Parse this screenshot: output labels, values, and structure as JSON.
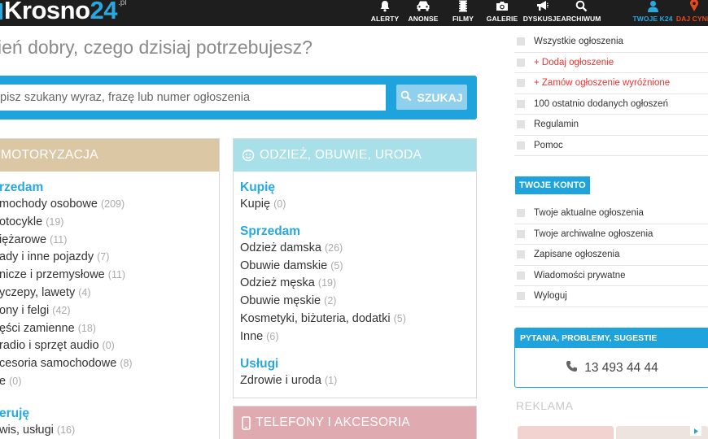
{
  "header": {
    "logo_text": "Krosno",
    "logo_num": "24",
    "logo_suffix": ".pl",
    "nav": [
      {
        "label": "ALERTY",
        "icon": "bell-icon"
      },
      {
        "label": "ANONSE",
        "icon": "car-icon"
      },
      {
        "label": "FILMY",
        "icon": "film-icon"
      },
      {
        "label": "GALERIE",
        "icon": "camera-icon"
      },
      {
        "label": "DYSKUSJE",
        "icon": "megaphone-icon"
      },
      {
        "label": "ARCHIWUM",
        "icon": "search-icon"
      },
      {
        "label": "TWOJE K24",
        "icon": "user-icon"
      },
      {
        "label": "DAJ CYNK",
        "icon": "pin-icon"
      }
    ]
  },
  "greeting": "ień dobry, czego dzisiaj potrzebujesz?",
  "search": {
    "placeholder": "pisz szukany wyraz, frazę lub numer ogłoszenia",
    "button_label": "SZUKAJ"
  },
  "colors": {
    "accent": "#1fa3dc",
    "moto_header": "#dcc7a5",
    "odziez_header": "#a8e0ea",
    "telefony_header": "#dfaab0"
  },
  "categories": {
    "moto": {
      "title": "MOTORYZACJA",
      "sections": [
        {
          "title": "rzedam",
          "items": [
            {
              "label": "mochody osobowe",
              "count": "(209)"
            },
            {
              "label": "otocykle",
              "count": "(19)"
            },
            {
              "label": "iężarowe",
              "count": "(11)"
            },
            {
              "label": "ady i inne pojazdy",
              "count": "(7)"
            },
            {
              "label": "nicze i przemysłowe",
              "count": "(11)"
            },
            {
              "label": "yczepy, lawety",
              "count": "(4)"
            },
            {
              "label": "ony i felgi",
              "count": "(42)"
            },
            {
              "label": "ęści zamienne",
              "count": "(18)"
            },
            {
              "label": "radio i sprzęt audio",
              "count": "(0)"
            },
            {
              "label": "cesoria samochodowe",
              "count": "(8)"
            },
            {
              "label": "e",
              "count": "(0)"
            }
          ]
        },
        {
          "title": "eruję",
          "items": [
            {
              "label": "wis, usługi",
              "count": "(16)"
            }
          ]
        }
      ]
    },
    "odziez": {
      "title": "ODZIEŻ, OBUWIE, URODA",
      "sections": [
        {
          "title": "Kupię",
          "items": [
            {
              "label": "Kupię",
              "count": "(0)"
            }
          ]
        },
        {
          "title": "Sprzedam",
          "items": [
            {
              "label": "Odzież damska",
              "count": "(26)"
            },
            {
              "label": "Obuwie damskie",
              "count": "(5)"
            },
            {
              "label": "Odzież męska",
              "count": "(19)"
            },
            {
              "label": "Obuwie męskie",
              "count": "(2)"
            },
            {
              "label": "Kosmetyki, biżuteria, dodatki",
              "count": "(5)"
            },
            {
              "label": "Inne",
              "count": "(6)"
            }
          ]
        },
        {
          "title": "Usługi",
          "items": [
            {
              "label": "Zdrowie i uroda",
              "count": "(1)"
            }
          ]
        }
      ]
    },
    "telefony": {
      "title": "TELEFONY I AKCESORIA"
    }
  },
  "sidebar": {
    "ogloszenia": [
      {
        "label": "Wszystkie ogłoszenia",
        "highlight": false
      },
      {
        "label": "+ Dodaj ogłoszenie",
        "highlight": true
      },
      {
        "label": "+ Zamów ogłoszenie wyróżnione",
        "highlight": true
      },
      {
        "label": "100 ostatnio dodanych ogłoszeń",
        "highlight": false
      },
      {
        "label": "Regulamin",
        "highlight": false
      },
      {
        "label": "Pomoc",
        "highlight": false
      }
    ],
    "konto_title": "TWOJE KONTO",
    "konto": [
      {
        "label": "Twoje aktualne ogłoszenia"
      },
      {
        "label": "Twoje archiwalne ogłoszenia"
      },
      {
        "label": "Zapisane ogłoszenia"
      },
      {
        "label": "Wiadomości prywatne"
      },
      {
        "label": "Wyloguj"
      }
    ],
    "contact": {
      "title": "PYTANIA, PROBLEMY, SUGESTIE",
      "phone": "13 493 44 44"
    },
    "reklama": "REKLAMA"
  }
}
